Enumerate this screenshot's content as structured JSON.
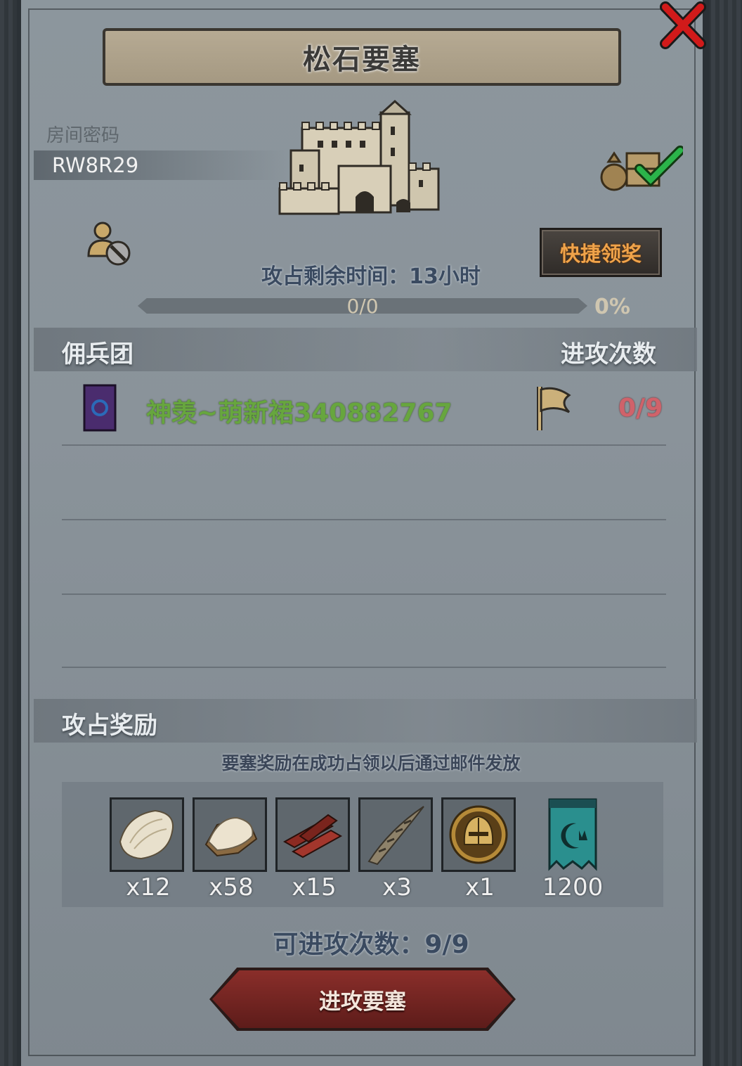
{
  "title": "松石要塞",
  "room": {
    "label": "房间密码",
    "code": "RW8R29"
  },
  "quick_claim_label": "快捷领奖",
  "time_remaining": "攻占剩余时间：13小时",
  "progress": {
    "count_text": "0/0",
    "percent_text": "0%",
    "fraction": 0
  },
  "guild_section": {
    "title": "佣兵团",
    "attacks_header": "进攻次数"
  },
  "guild_rows": [
    {
      "name": "神羡~萌新裙340882767",
      "attacks": "0/9"
    }
  ],
  "rewards_section": {
    "title": "攻占奖励",
    "note": "要塞奖励在成功占领以后通过邮件发放",
    "items": [
      {
        "icon": "fur-pelt-icon",
        "qty": "x12"
      },
      {
        "icon": "wool-hide-icon",
        "qty": "x58"
      },
      {
        "icon": "wood-planks-icon",
        "qty": "x15"
      },
      {
        "icon": "horn-icon",
        "qty": "x3"
      },
      {
        "icon": "knight-helmet-medal-icon",
        "qty": "x1"
      },
      {
        "icon": "guild-banner-icon",
        "qty": "1200"
      }
    ]
  },
  "attacks_available": "可进攻次数：9/9",
  "attack_button_label": "进攻要塞",
  "colors": {
    "guild_name": "#67a63e",
    "attack_count": "#d0626a",
    "quick_claim_text": "#f0a34a",
    "attack_button": "#7a2724"
  }
}
